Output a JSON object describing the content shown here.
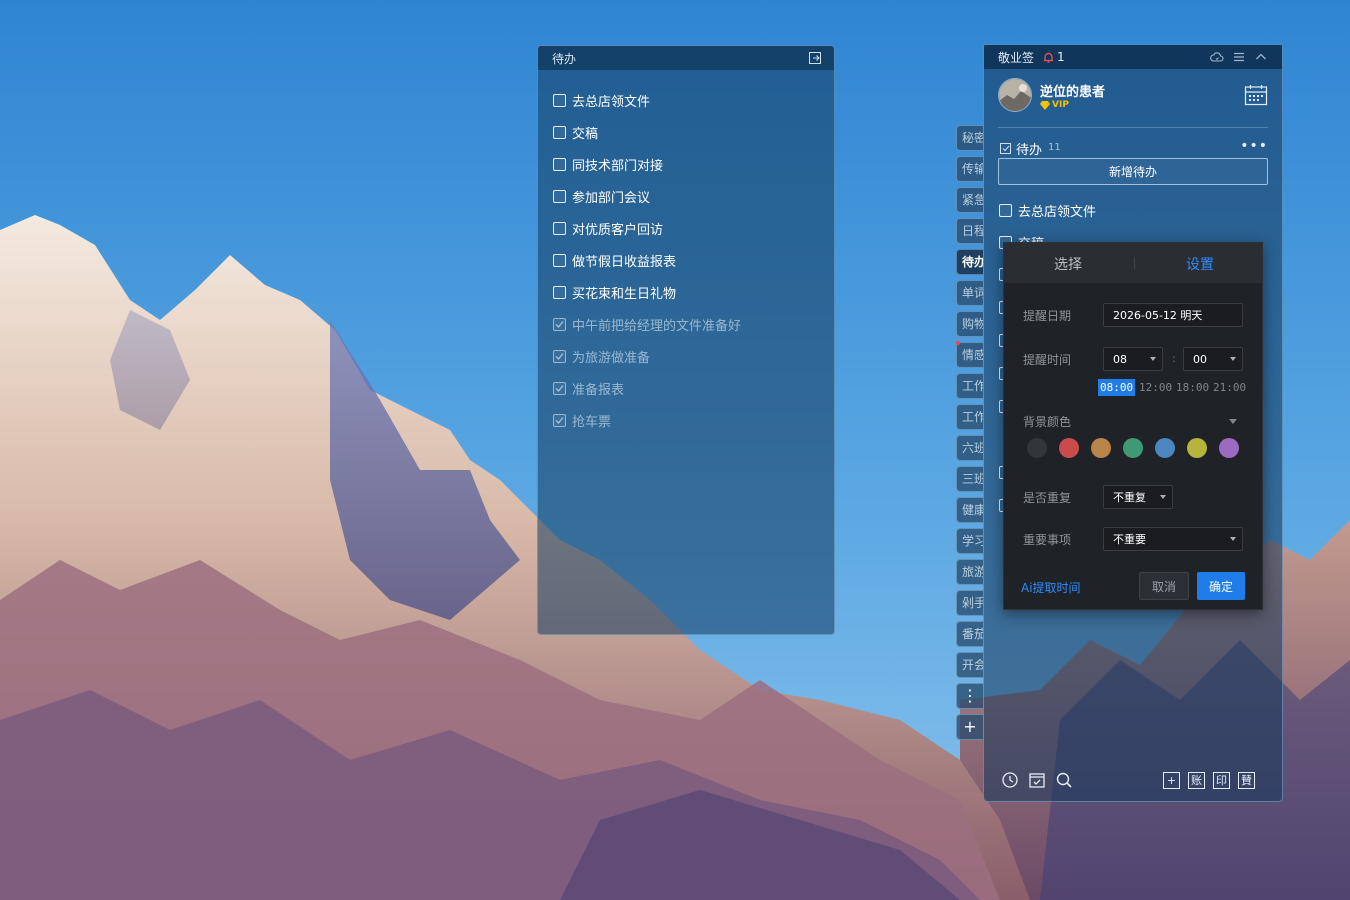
{
  "floating_widget": {
    "title": "待办",
    "items": [
      {
        "text": "去总店领文件",
        "done": false
      },
      {
        "text": "交稿",
        "done": false
      },
      {
        "text": "同技术部门对接",
        "done": false
      },
      {
        "text": "参加部门会议",
        "done": false
      },
      {
        "text": "对优质客户回访",
        "done": false
      },
      {
        "text": "做节假日收益报表",
        "done": false
      },
      {
        "text": "买花束和生日礼物",
        "done": false
      },
      {
        "text": "中午前把给经理的文件准备好",
        "done": true
      },
      {
        "text": "为旅游做准备",
        "done": true
      },
      {
        "text": "准备报表",
        "done": true
      },
      {
        "text": "抢车票",
        "done": true
      }
    ]
  },
  "side_tabs": [
    "秘密",
    "传输",
    "紧急",
    "日程",
    "待办",
    "单词",
    "购物",
    "情感",
    "工作",
    "工作",
    "六班",
    "三班",
    "健康",
    "学习",
    "旅游",
    "剁手",
    "番茄",
    "开会"
  ],
  "side_tab_active": "待办",
  "side_tab_more": "⋮",
  "side_tab_add": "+",
  "app": {
    "title": "敬业签",
    "bell_count": "1",
    "user": {
      "name": "逆位的患者",
      "badge": "VIP"
    },
    "todo_section": {
      "title": "待办",
      "count": "11",
      "more": "•••"
    },
    "add_button": "新增待办",
    "visible_items": [
      "去总店领文件",
      "交稿"
    ],
    "footer_boxes": [
      "+",
      "账",
      "印",
      "賛"
    ]
  },
  "popup": {
    "tab_select": "选择",
    "tab_settings": "设置",
    "remind_date_label": "提醒日期",
    "remind_date_value": "2026-05-12 明天",
    "remind_time_label": "提醒时间",
    "hour": "08",
    "minute": "00",
    "colon": ":",
    "time_presets": [
      "08:00",
      "12:00",
      "18:00",
      "21:00"
    ],
    "selected_preset": "08:00",
    "bg_color_label": "背景颜色",
    "colors": [
      "#333639",
      "#c94b4b",
      "#b8844a",
      "#3d9a74",
      "#4a86c0",
      "#b8b33c",
      "#9a6bc0"
    ],
    "repeat_label": "是否重复",
    "repeat_value": "不重复",
    "important_label": "重要事项",
    "important_value": "不重要",
    "ai_link": "Ai提取时间",
    "cancel": "取消",
    "confirm": "确定"
  },
  "colors": {
    "accent": "#1f7ce8",
    "vip": "#f2c300",
    "bell": "#ff4d4d"
  }
}
